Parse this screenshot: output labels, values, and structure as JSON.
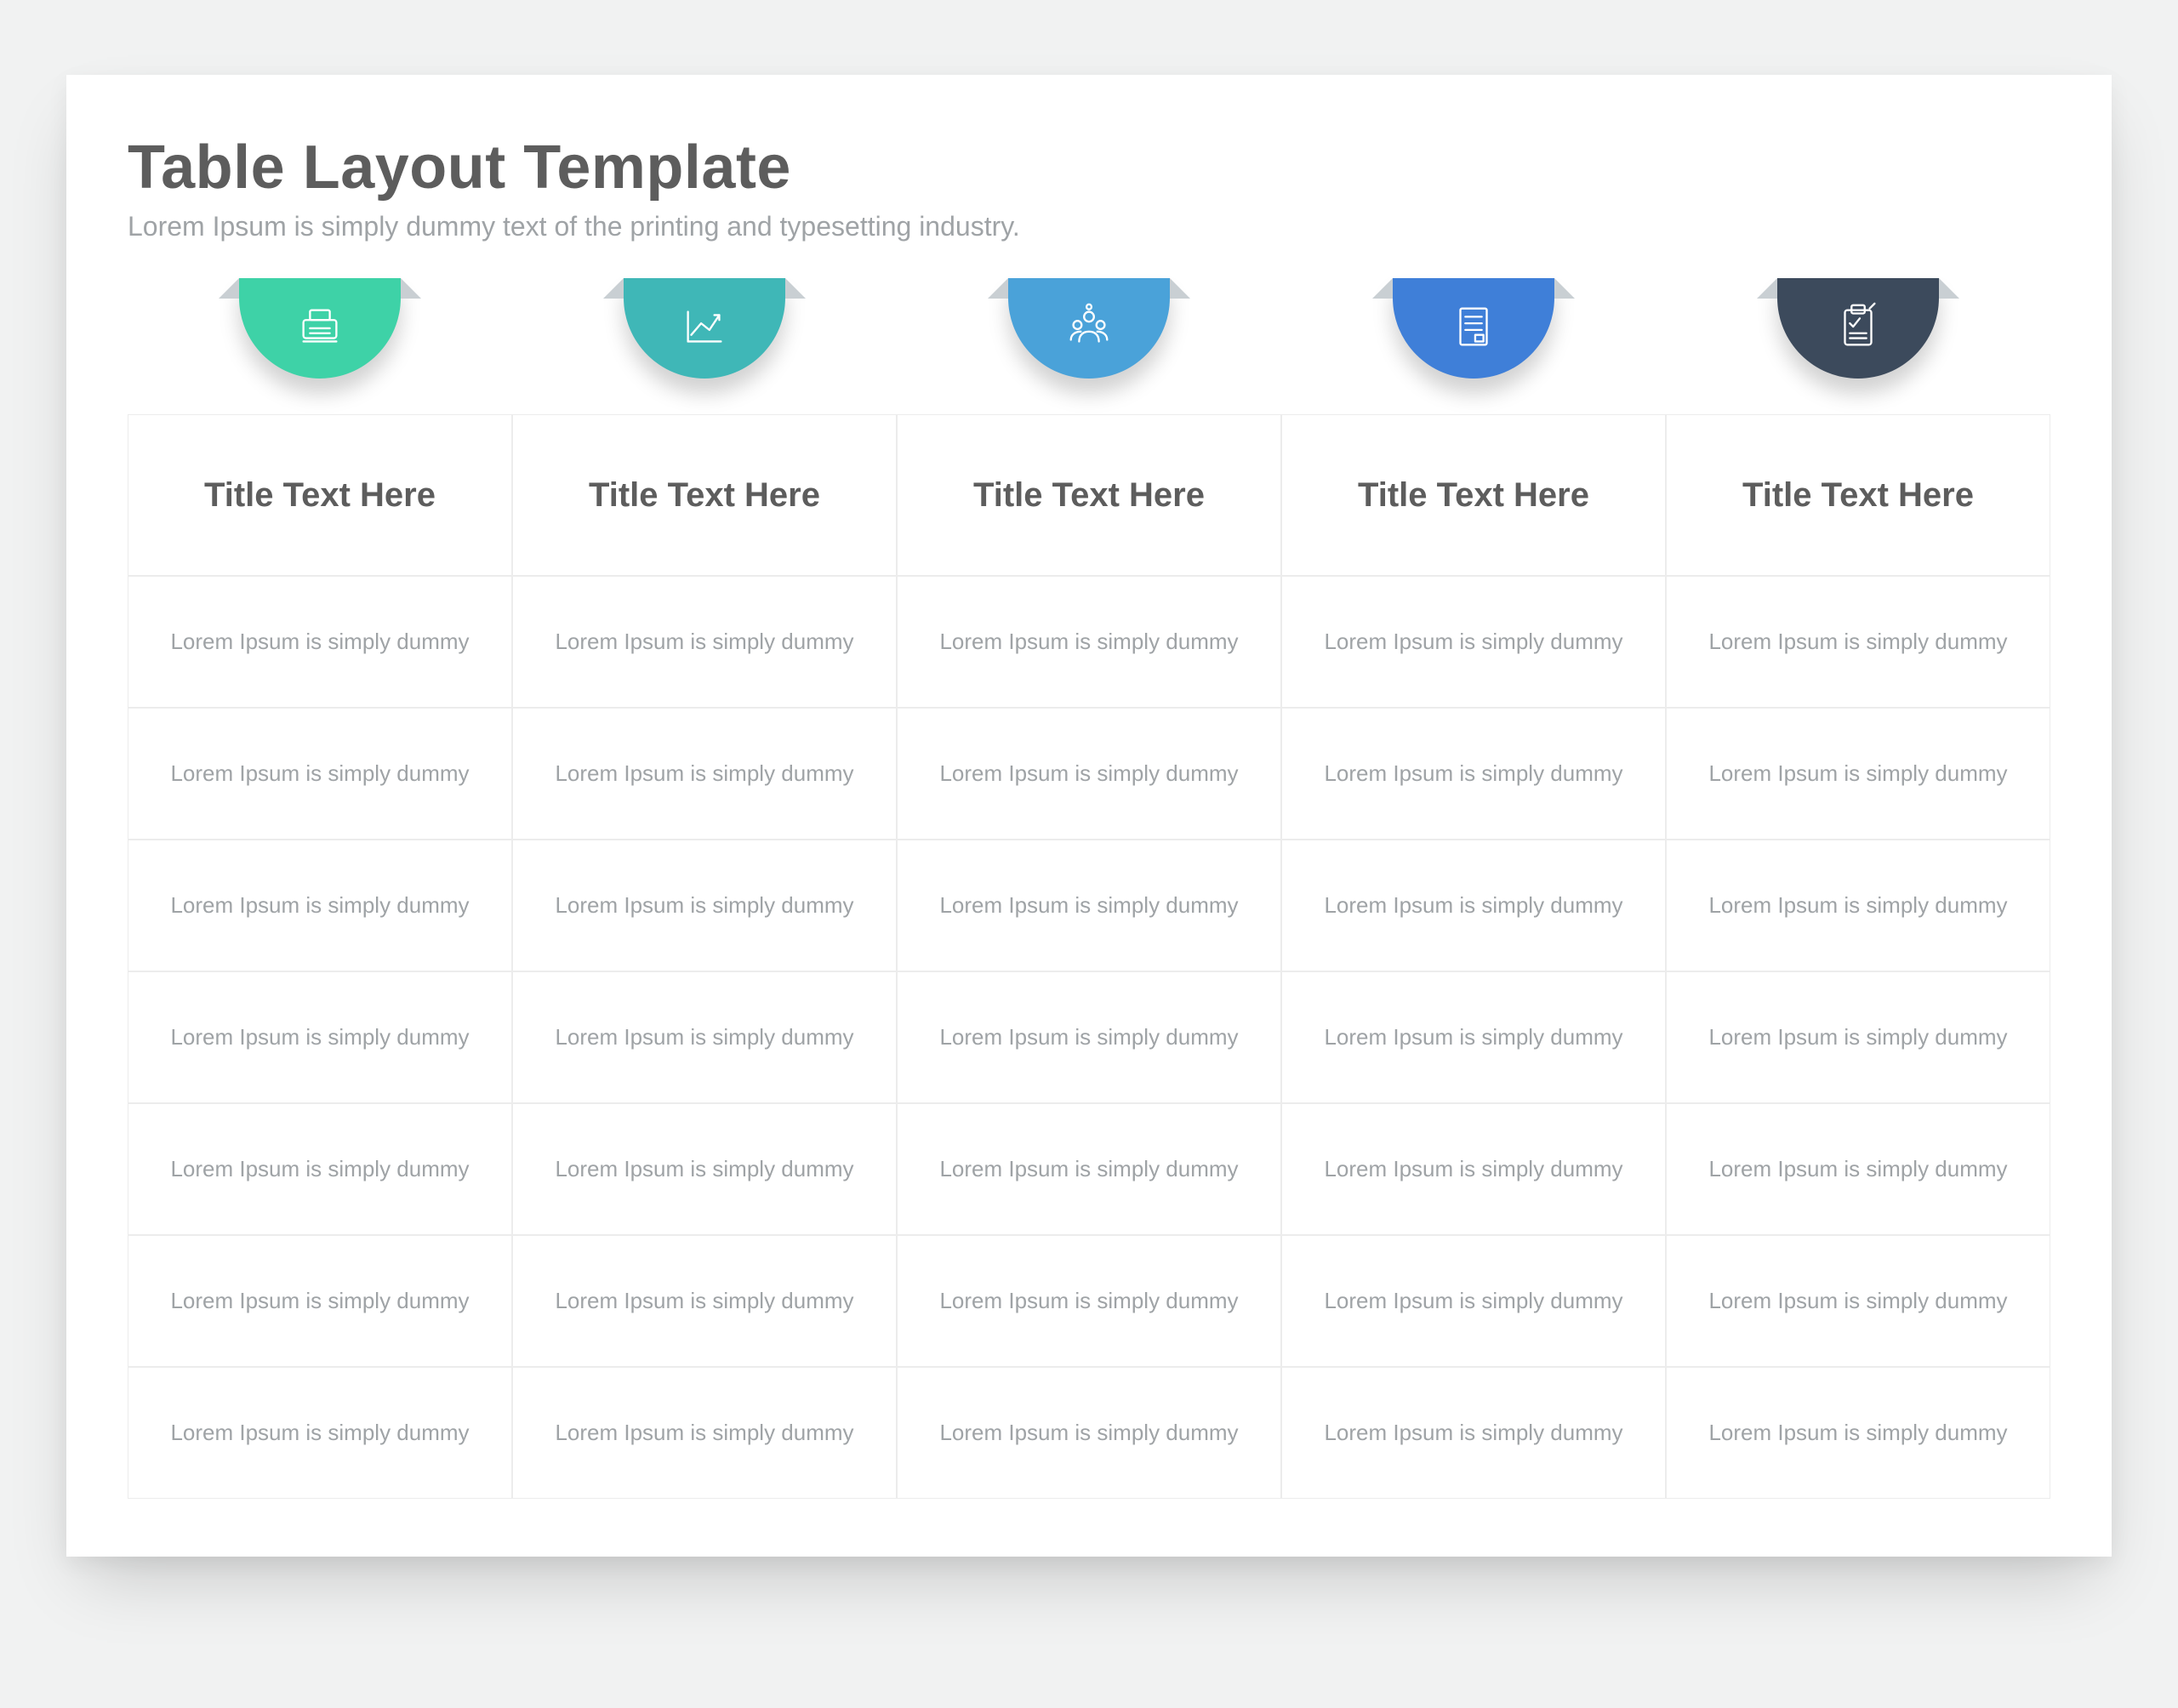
{
  "header": {
    "title": "Table Layout Template",
    "subtitle": "Lorem Ipsum is simply dummy text of the printing and typesetting industry."
  },
  "columns": [
    {
      "color": "#3ed2a7",
      "icon": "typewriter-icon",
      "title": "Title Text Here"
    },
    {
      "color": "#3fb7b7",
      "icon": "chart-icon",
      "title": "Title Text Here"
    },
    {
      "color": "#4aa2d9",
      "icon": "team-icon",
      "title": "Title Text Here"
    },
    {
      "color": "#3f7fd8",
      "icon": "document-icon",
      "title": "Title Text Here"
    },
    {
      "color": "#3c4a5c",
      "icon": "clipboard-icon",
      "title": "Title Text Here"
    }
  ],
  "row_text": "Lorem Ipsum is simply dummy",
  "row_count": 7
}
